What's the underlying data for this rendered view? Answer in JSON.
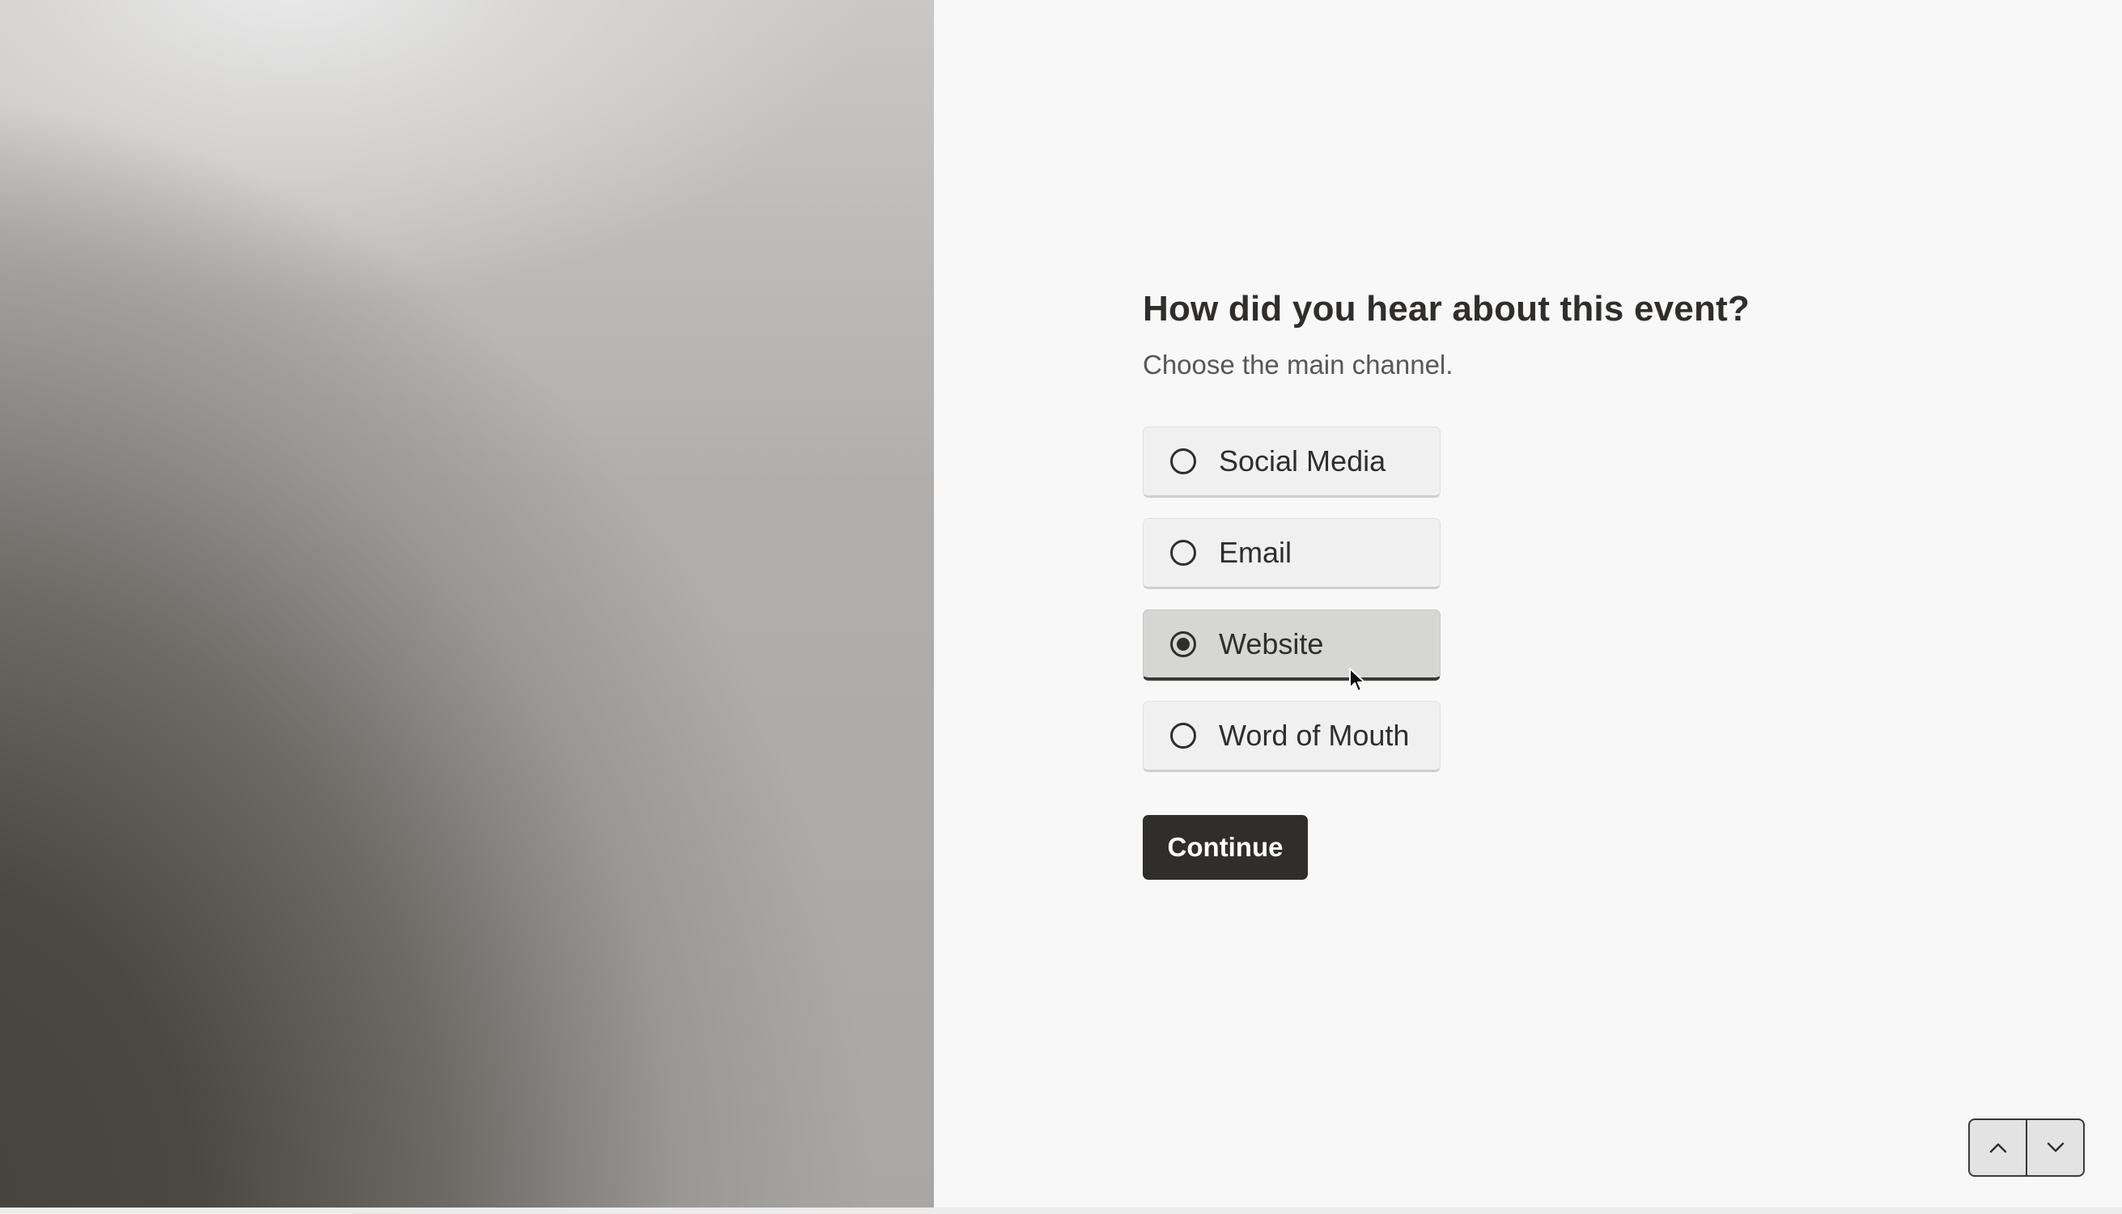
{
  "form": {
    "question": "How did you hear about this event?",
    "hint": "Choose the main channel.",
    "options": [
      {
        "label": "Social Media",
        "selected": false
      },
      {
        "label": "Email",
        "selected": false
      },
      {
        "label": "Website",
        "selected": true
      },
      {
        "label": "Word of Mouth",
        "selected": false
      }
    ],
    "continue_label": "Continue"
  },
  "navigation": {
    "previous_icon": "chevron-up-icon",
    "next_icon": "chevron-down-icon"
  },
  "colors": {
    "text_primary": "#2f2e2c",
    "button_background": "#2f2e2c",
    "page_background": "#f8f8f8"
  }
}
